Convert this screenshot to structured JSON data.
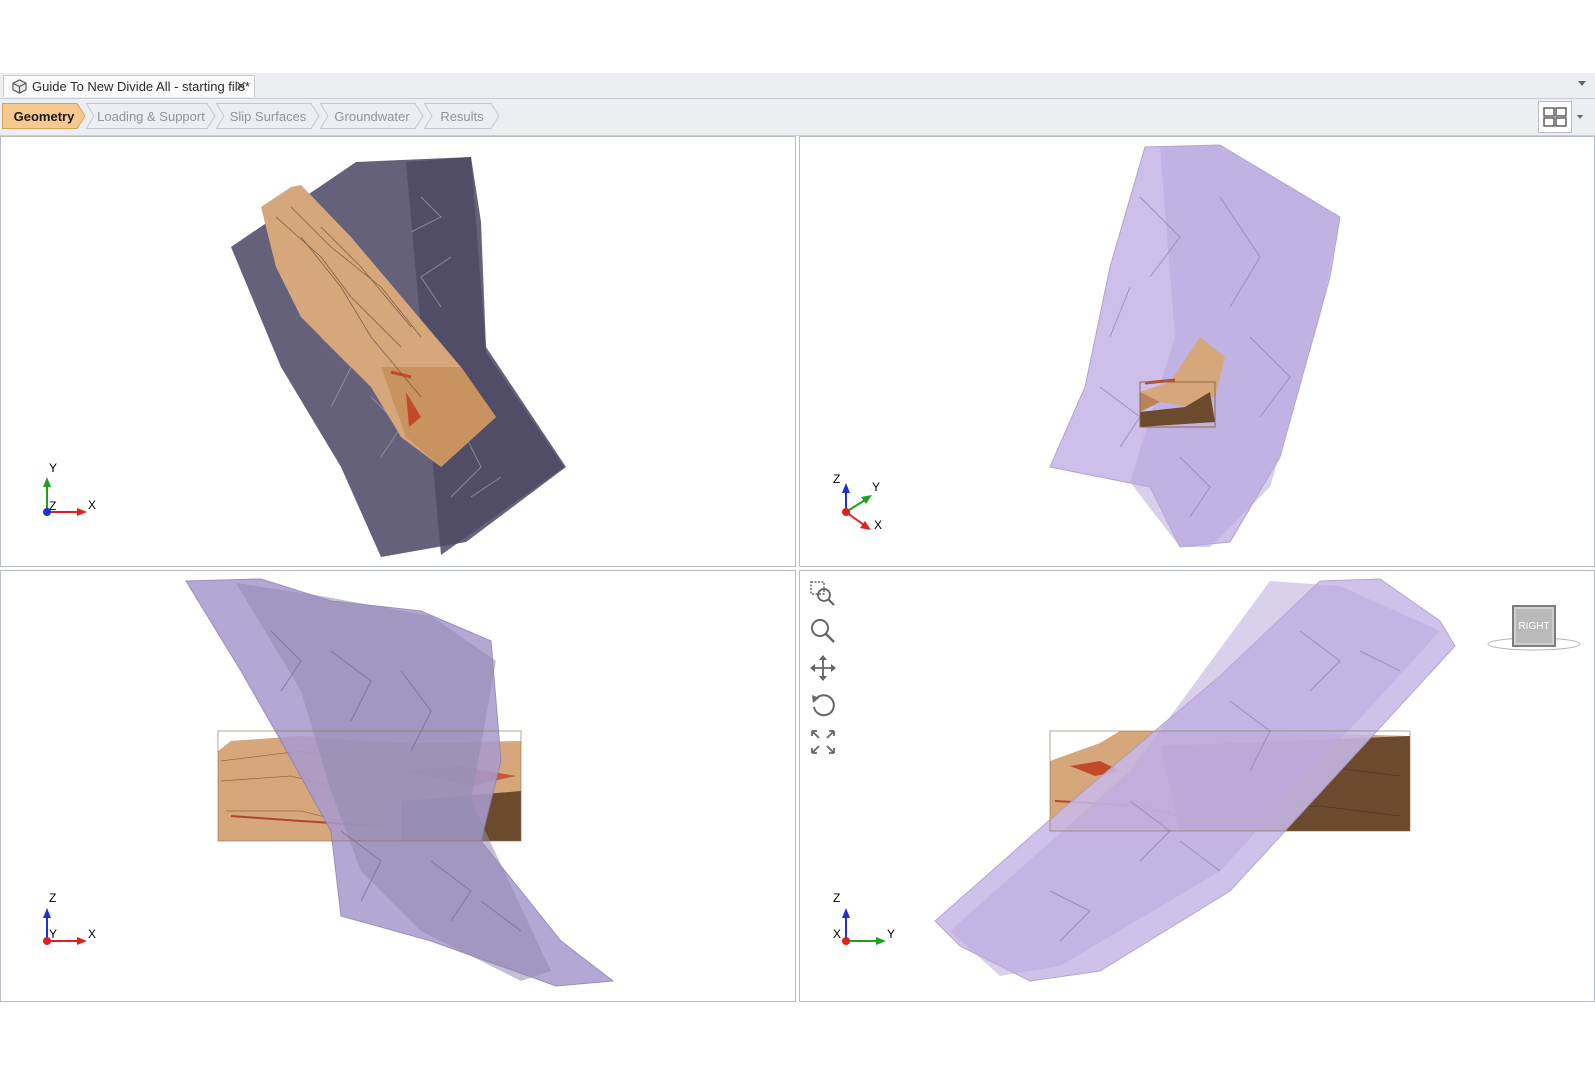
{
  "document_tab": {
    "title": "Guide To New Divide All - starting file*",
    "close_glyph": "✕",
    "icon": "document-cube-icon"
  },
  "workflow": {
    "steps": [
      {
        "label": "Geometry",
        "active": true
      },
      {
        "label": "Loading & Support",
        "active": false
      },
      {
        "label": "Slip Surfaces",
        "active": false
      },
      {
        "label": "Groundwater",
        "active": false
      },
      {
        "label": "Results",
        "active": false
      }
    ],
    "layout_button_icon": "four-viewport-layout-icon"
  },
  "viewports": {
    "top_left": {
      "axes": [
        "Y",
        "Z",
        "X"
      ]
    },
    "top_right": {
      "axes": [
        "Z",
        "Y",
        "X"
      ]
    },
    "bottom_left": {
      "axes": [
        "Z",
        "Y",
        "X"
      ]
    },
    "bottom_right": {
      "axes": [
        "Z",
        "X",
        "Y"
      ],
      "nav_tools": [
        "zoom-window-icon",
        "zoom-icon",
        "pan-icon",
        "rotate-icon",
        "zoom-extents-icon"
      ],
      "viewcube_label": "RIGHT"
    }
  },
  "colors": {
    "workflow_active": "#f6c98f",
    "fault_dark": "#5e5873",
    "fault_light": "#c8b9e8",
    "terrain": "#d6a77a",
    "terrain_dark": "#6b4a2d",
    "axis_x": "#e02020",
    "axis_y": "#20a020",
    "axis_z": "#2030d0"
  }
}
